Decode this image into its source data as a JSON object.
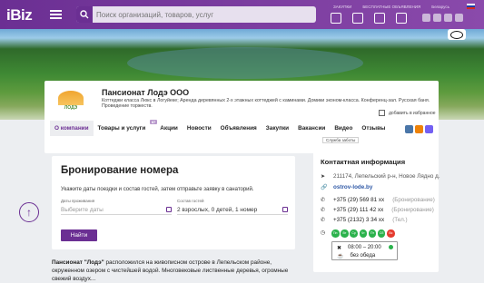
{
  "header": {
    "logo": "iBiz",
    "search_placeholder": "Поиск организаций, товаров, услуг",
    "links": [
      "ЗАКУПКИ",
      "БЕСПЛАТНЫЕ ОБЪЯВЛЕНИЯ",
      "Беларусь"
    ]
  },
  "company": {
    "logo_text": "ЛОДЭ",
    "name": "Пансионат Лодэ ООО",
    "description": "Коттеджи класса Люкс в Логуйеке; Аренда деревянных 2-х этажных коттеджей с каминами. Домики эконом-класса. Конференц-зал. Русская баня. Проведение торжеств.",
    "favorite": "добавить в избранное",
    "tabs": [
      {
        "label": "О компании",
        "active": true
      },
      {
        "label": "Товары и услуги",
        "badge": "87"
      },
      {
        "label": "Акции"
      },
      {
        "label": "Новости"
      },
      {
        "label": "Объявления"
      },
      {
        "label": "Закупки"
      },
      {
        "label": "Вакансии"
      },
      {
        "label": "Видео"
      },
      {
        "label": "Отзывы"
      }
    ],
    "support": "Служба заботы"
  },
  "booking": {
    "title": "Бронирование номера",
    "subtitle": "Укажите даты поездки и состав гостей, затем отправьте заявку в санаторий.",
    "dates_label": "Даты проживания",
    "dates_placeholder": "Выберите даты",
    "guests_label": "Состав гостей",
    "guests_value": "2 взрослых, 0 детей, 1 номер",
    "submit": "Найти"
  },
  "about": {
    "name": "Пансионат \"Лодэ\"",
    "text": " расположился на живописном острове в Лепельском районе, окруженном озером с чистейшей водой. Многовековые лиственные деревья, огромные свежий воздух..."
  },
  "contact": {
    "title": "Контактная информация",
    "address": "211174, Лепельский р-н, Новое Лядно д.",
    "website": "ostrov-lode.by",
    "phones": [
      {
        "number": "+375 (29) 569 81 xx",
        "note": "(Бронирование)"
      },
      {
        "number": "+375 (29) 111 42 xx",
        "note": "(Бронирование)"
      },
      {
        "number": "+375 (2132) 3 34 xx",
        "note": "(Тел.)"
      }
    ],
    "days": [
      "Пн",
      "Вт",
      "Ср",
      "Чт",
      "Пт",
      "Сб",
      "Вс"
    ],
    "hours": "08:00 – 20:00",
    "break": "без обеда"
  },
  "colors": {
    "brand": "#6b2f93",
    "open": "#2bb24c",
    "closed": "#e53b2f"
  }
}
